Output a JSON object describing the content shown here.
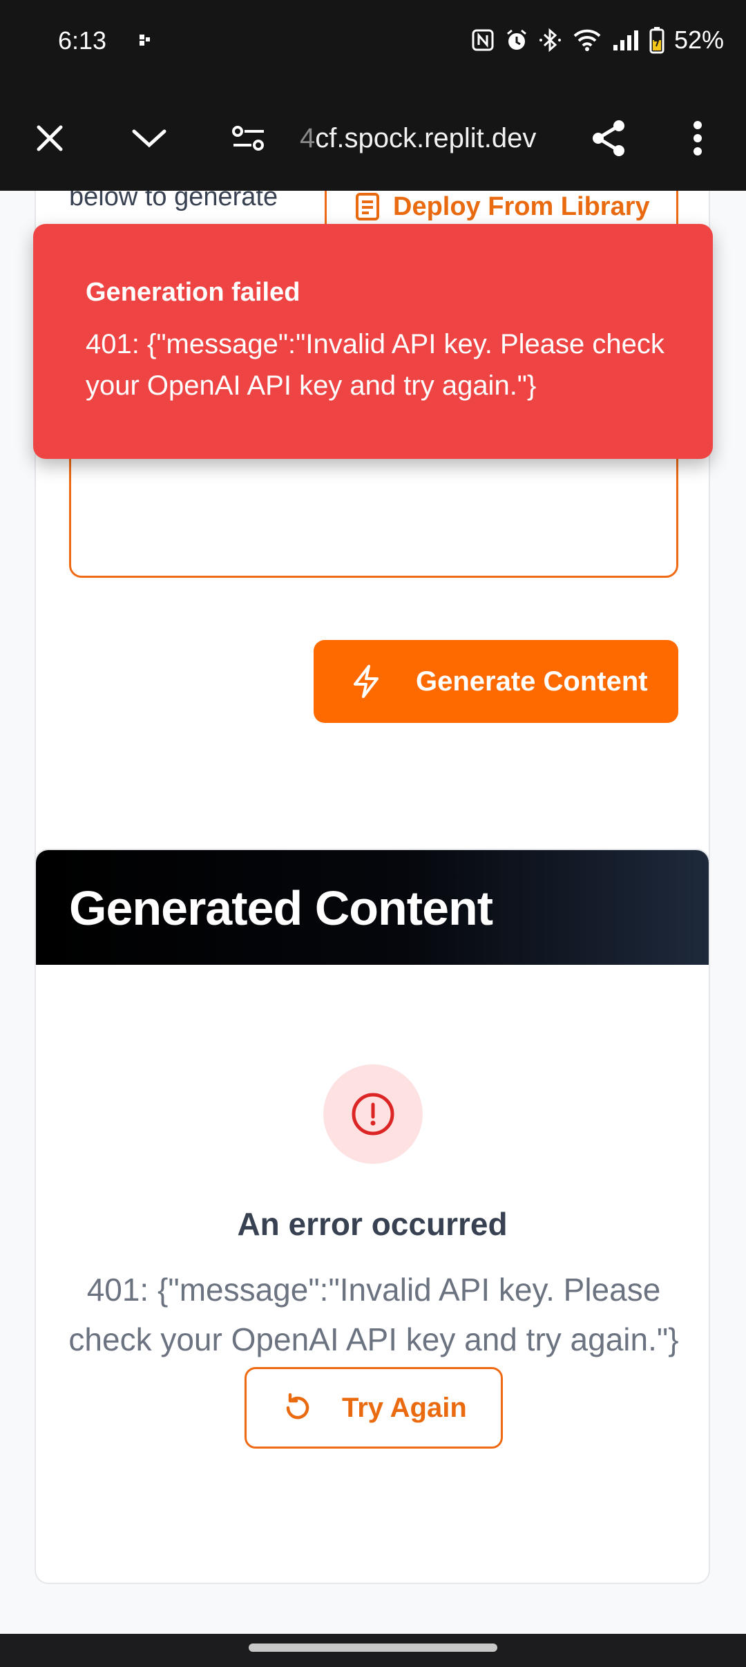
{
  "status_bar": {
    "time": "6:13",
    "battery": "52%",
    "icons": [
      "nfc-icon",
      "alarm-icon",
      "bluetooth-icon",
      "wifi-icon",
      "signal-icon",
      "battery-icon"
    ]
  },
  "browser": {
    "url_faded": "4",
    "url": "cf.spock.replit.dev"
  },
  "form_card": {
    "partial_text": "below to generate",
    "deploy_button": "Deploy From Library",
    "generate_button": "Generate Content"
  },
  "output_card": {
    "title": "Generated Content",
    "error_title": "An error occurred",
    "error_message": "401: {\"message\":\"Invalid API key. Please check your OpenAI API key and try again.\"}",
    "retry_button": "Try Again"
  },
  "toast": {
    "title": "Generation failed",
    "message": "401: {\"message\":\"Invalid API key. Please check your OpenAI API key and try again.\"}"
  },
  "colors": {
    "accent": "#ff6a00",
    "toast_bg": "#ef4444",
    "error_icon": "#dc2626"
  }
}
